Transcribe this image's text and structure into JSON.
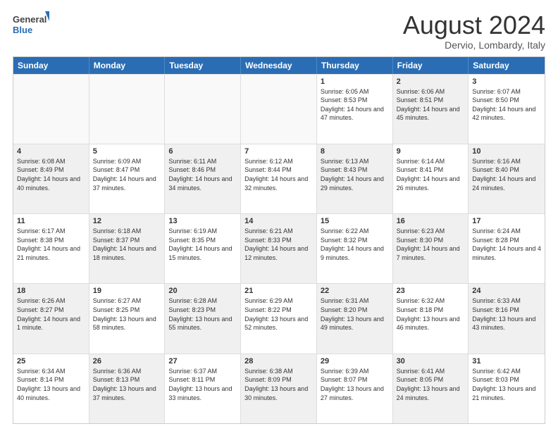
{
  "header": {
    "logo_line1": "General",
    "logo_line2": "Blue",
    "month_year": "August 2024",
    "location": "Dervio, Lombardy, Italy"
  },
  "days_of_week": [
    "Sunday",
    "Monday",
    "Tuesday",
    "Wednesday",
    "Thursday",
    "Friday",
    "Saturday"
  ],
  "weeks": [
    [
      {
        "day": "",
        "text": "",
        "empty": true
      },
      {
        "day": "",
        "text": "",
        "empty": true
      },
      {
        "day": "",
        "text": "",
        "empty": true
      },
      {
        "day": "",
        "text": "",
        "empty": true
      },
      {
        "day": "1",
        "text": "Sunrise: 6:05 AM\nSunset: 8:53 PM\nDaylight: 14 hours and 47 minutes.",
        "empty": false
      },
      {
        "day": "2",
        "text": "Sunrise: 6:06 AM\nSunset: 8:51 PM\nDaylight: 14 hours and 45 minutes.",
        "empty": false
      },
      {
        "day": "3",
        "text": "Sunrise: 6:07 AM\nSunset: 8:50 PM\nDaylight: 14 hours and 42 minutes.",
        "empty": false
      }
    ],
    [
      {
        "day": "4",
        "text": "Sunrise: 6:08 AM\nSunset: 8:49 PM\nDaylight: 14 hours and 40 minutes.",
        "empty": false
      },
      {
        "day": "5",
        "text": "Sunrise: 6:09 AM\nSunset: 8:47 PM\nDaylight: 14 hours and 37 minutes.",
        "empty": false
      },
      {
        "day": "6",
        "text": "Sunrise: 6:11 AM\nSunset: 8:46 PM\nDaylight: 14 hours and 34 minutes.",
        "empty": false
      },
      {
        "day": "7",
        "text": "Sunrise: 6:12 AM\nSunset: 8:44 PM\nDaylight: 14 hours and 32 minutes.",
        "empty": false
      },
      {
        "day": "8",
        "text": "Sunrise: 6:13 AM\nSunset: 8:43 PM\nDaylight: 14 hours and 29 minutes.",
        "empty": false
      },
      {
        "day": "9",
        "text": "Sunrise: 6:14 AM\nSunset: 8:41 PM\nDaylight: 14 hours and 26 minutes.",
        "empty": false
      },
      {
        "day": "10",
        "text": "Sunrise: 6:16 AM\nSunset: 8:40 PM\nDaylight: 14 hours and 24 minutes.",
        "empty": false
      }
    ],
    [
      {
        "day": "11",
        "text": "Sunrise: 6:17 AM\nSunset: 8:38 PM\nDaylight: 14 hours and 21 minutes.",
        "empty": false
      },
      {
        "day": "12",
        "text": "Sunrise: 6:18 AM\nSunset: 8:37 PM\nDaylight: 14 hours and 18 minutes.",
        "empty": false
      },
      {
        "day": "13",
        "text": "Sunrise: 6:19 AM\nSunset: 8:35 PM\nDaylight: 14 hours and 15 minutes.",
        "empty": false
      },
      {
        "day": "14",
        "text": "Sunrise: 6:21 AM\nSunset: 8:33 PM\nDaylight: 14 hours and 12 minutes.",
        "empty": false
      },
      {
        "day": "15",
        "text": "Sunrise: 6:22 AM\nSunset: 8:32 PM\nDaylight: 14 hours and 9 minutes.",
        "empty": false
      },
      {
        "day": "16",
        "text": "Sunrise: 6:23 AM\nSunset: 8:30 PM\nDaylight: 14 hours and 7 minutes.",
        "empty": false
      },
      {
        "day": "17",
        "text": "Sunrise: 6:24 AM\nSunset: 8:28 PM\nDaylight: 14 hours and 4 minutes.",
        "empty": false
      }
    ],
    [
      {
        "day": "18",
        "text": "Sunrise: 6:26 AM\nSunset: 8:27 PM\nDaylight: 14 hours and 1 minute.",
        "empty": false
      },
      {
        "day": "19",
        "text": "Sunrise: 6:27 AM\nSunset: 8:25 PM\nDaylight: 13 hours and 58 minutes.",
        "empty": false
      },
      {
        "day": "20",
        "text": "Sunrise: 6:28 AM\nSunset: 8:23 PM\nDaylight: 13 hours and 55 minutes.",
        "empty": false
      },
      {
        "day": "21",
        "text": "Sunrise: 6:29 AM\nSunset: 8:22 PM\nDaylight: 13 hours and 52 minutes.",
        "empty": false
      },
      {
        "day": "22",
        "text": "Sunrise: 6:31 AM\nSunset: 8:20 PM\nDaylight: 13 hours and 49 minutes.",
        "empty": false
      },
      {
        "day": "23",
        "text": "Sunrise: 6:32 AM\nSunset: 8:18 PM\nDaylight: 13 hours and 46 minutes.",
        "empty": false
      },
      {
        "day": "24",
        "text": "Sunrise: 6:33 AM\nSunset: 8:16 PM\nDaylight: 13 hours and 43 minutes.",
        "empty": false
      }
    ],
    [
      {
        "day": "25",
        "text": "Sunrise: 6:34 AM\nSunset: 8:14 PM\nDaylight: 13 hours and 40 minutes.",
        "empty": false
      },
      {
        "day": "26",
        "text": "Sunrise: 6:36 AM\nSunset: 8:13 PM\nDaylight: 13 hours and 37 minutes.",
        "empty": false
      },
      {
        "day": "27",
        "text": "Sunrise: 6:37 AM\nSunset: 8:11 PM\nDaylight: 13 hours and 33 minutes.",
        "empty": false
      },
      {
        "day": "28",
        "text": "Sunrise: 6:38 AM\nSunset: 8:09 PM\nDaylight: 13 hours and 30 minutes.",
        "empty": false
      },
      {
        "day": "29",
        "text": "Sunrise: 6:39 AM\nSunset: 8:07 PM\nDaylight: 13 hours and 27 minutes.",
        "empty": false
      },
      {
        "day": "30",
        "text": "Sunrise: 6:41 AM\nSunset: 8:05 PM\nDaylight: 13 hours and 24 minutes.",
        "empty": false
      },
      {
        "day": "31",
        "text": "Sunrise: 6:42 AM\nSunset: 8:03 PM\nDaylight: 13 hours and 21 minutes.",
        "empty": false
      }
    ]
  ]
}
